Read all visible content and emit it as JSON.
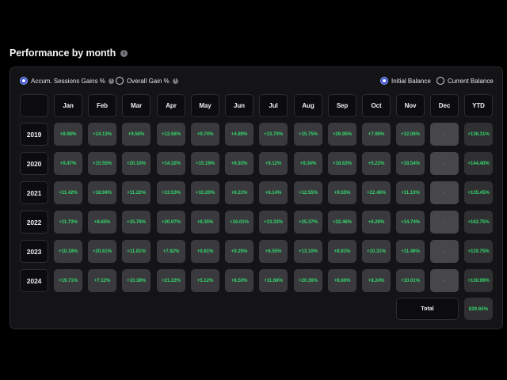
{
  "header": {
    "title": "Performance by month"
  },
  "options": {
    "accum_label": "Accum. Sessions Gains %",
    "overall_label": "Overall Gain %",
    "initial_label": "Initial Balance",
    "current_label": "Current Balance",
    "accum_selected": true,
    "overall_selected": false,
    "initial_selected": true,
    "current_selected": false
  },
  "table": {
    "columns": [
      "Jan",
      "Feb",
      "Mar",
      "Apr",
      "May",
      "Jun",
      "Jul",
      "Aug",
      "Sep",
      "Oct",
      "Nov",
      "Dec",
      "YTD"
    ],
    "rows": [
      {
        "year": "2019",
        "values": [
          "+8.98%",
          "+14.13%",
          "+9.56%",
          "+12.56%",
          "+9.74%",
          "+4.89%",
          "+13.70%",
          "+15.75%",
          "+26.95%",
          "+7.99%",
          "+12.06%",
          "-"
        ],
        "ytd": "+136.31%"
      },
      {
        "year": "2020",
        "values": [
          "+9.47%",
          "+15.55%",
          "+20.10%",
          "+14.32%",
          "+15.19%",
          "+8.93%",
          "+9.12%",
          "+9.34%",
          "+18.63%",
          "+5.22%",
          "+18.54%",
          "-"
        ],
        "ytd": "+144.40%"
      },
      {
        "year": "2021",
        "values": [
          "+11.42%",
          "+18.94%",
          "+11.22%",
          "+13.53%",
          "+10.20%",
          "+8.31%",
          "+6.14%",
          "+12.55%",
          "+9.55%",
          "+22.46%",
          "+11.13%",
          "-"
        ],
        "ytd": "+135.45%"
      },
      {
        "year": "2022",
        "values": [
          "+11.73%",
          "+8.65%",
          "+15.76%",
          "+20.07%",
          "+8.35%",
          "+16.01%",
          "+13.33%",
          "+25.37%",
          "+22.46%",
          "+6.29%",
          "+14.74%",
          "-"
        ],
        "ytd": "+162.75%"
      },
      {
        "year": "2023",
        "values": [
          "+10.18%",
          "+20.61%",
          "+11.81%",
          "+7.82%",
          "+9.81%",
          "+9.25%",
          "+6.55%",
          "+13.10%",
          "+8.81%",
          "+10.31%",
          "+11.49%",
          "-"
        ],
        "ytd": "+119.75%"
      },
      {
        "year": "2024",
        "values": [
          "+19.71%",
          "+7.12%",
          "+10.38%",
          "+21.22%",
          "+5.12%",
          "+8.50%",
          "+11.68%",
          "+20.36%",
          "+8.66%",
          "+8.24%",
          "+10.01%",
          "-"
        ],
        "ytd": "+130.99%"
      }
    ],
    "total_label": "Total",
    "total_value": "829.65%"
  },
  "colors": {
    "gain": "#34d36a",
    "accent": "#3a4fd0"
  },
  "icons": {
    "info": "info-icon"
  }
}
